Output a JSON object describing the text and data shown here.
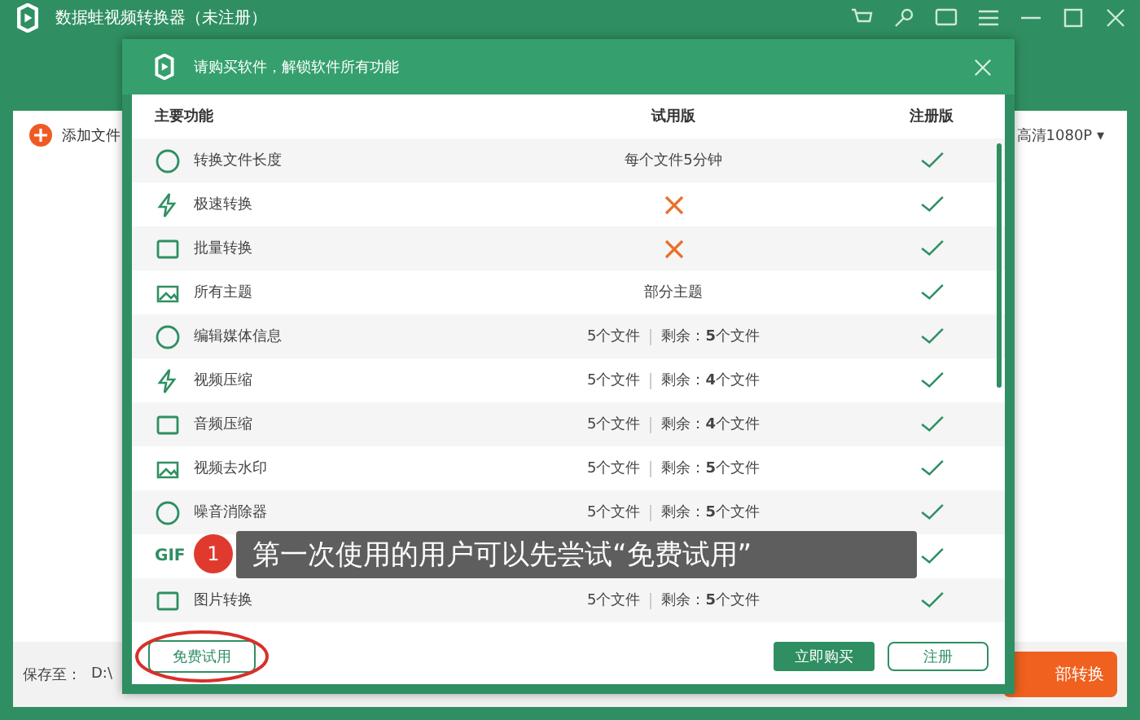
{
  "app": {
    "title": "数据蛙视频转换器（未注册）",
    "add_file": "添加文件",
    "quality": "高清1080P",
    "quality_caret": "▾",
    "save_label": "保存至：",
    "save_path": "D:\\",
    "convert": "部转换"
  },
  "dialog": {
    "title": "请购买软件，解锁软件所有功能",
    "columns": [
      "主要功能",
      "试用版",
      "注册版"
    ],
    "rows": [
      {
        "name": "转换文件长度",
        "trial": {
          "kind": "text",
          "text": "每个文件5分钟"
        },
        "registered": true
      },
      {
        "name": "极速转换",
        "trial": {
          "kind": "cross"
        },
        "registered": true
      },
      {
        "name": "批量转换",
        "trial": {
          "kind": "cross"
        },
        "registered": true
      },
      {
        "name": "所有主题",
        "trial": {
          "kind": "text",
          "text": "部分主题"
        },
        "registered": true
      },
      {
        "name": "编辑媒体信息",
        "trial": {
          "kind": "quota",
          "total": "5个文件",
          "remaining": "剩余：**5**个文件"
        },
        "registered": true
      },
      {
        "name": "视频压缩",
        "trial": {
          "kind": "quota",
          "total": "5个文件",
          "remaining": "剩余：**4**个文件"
        },
        "registered": true
      },
      {
        "name": "音频压缩",
        "trial": {
          "kind": "quota",
          "total": "5个文件",
          "remaining": "剩余：**4**个文件"
        },
        "registered": true
      },
      {
        "name": "视频去水印",
        "trial": {
          "kind": "quota",
          "total": "5个文件",
          "remaining": "剩余：**5**个文件"
        },
        "registered": true
      },
      {
        "name": "噪音消除器",
        "trial": {
          "kind": "quota",
          "total": "5个文件",
          "remaining": "剩余：**5**个文件"
        },
        "registered": true
      },
      {
        "icon_text": "GIF",
        "trial": {
          "kind": "hidden"
        },
        "registered": true
      },
      {
        "name": "图片转换",
        "trial": {
          "kind": "quota",
          "total": "5个文件",
          "remaining": "剩余：**5**个文件"
        },
        "registered": true
      }
    ],
    "buttons": {
      "trial": "免费试用",
      "buy": "立即购买",
      "register": "注册"
    }
  },
  "annotation": {
    "badge": "1",
    "tooltip": "第一次使用的用户可以先尝试“免费试用”"
  }
}
